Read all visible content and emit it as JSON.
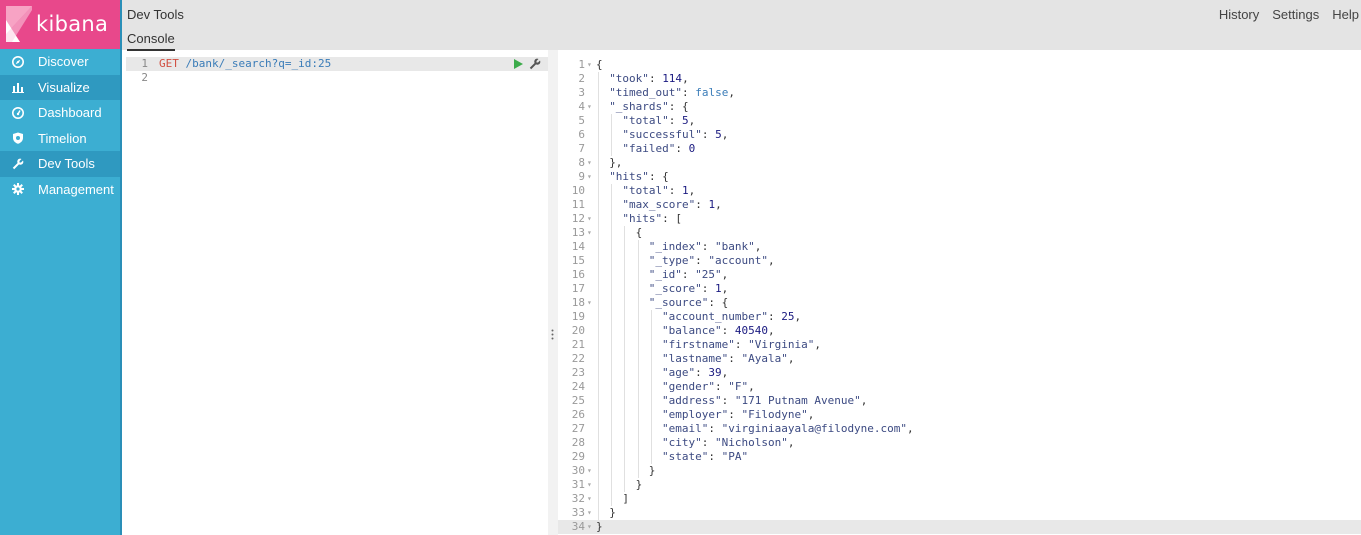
{
  "brand": {
    "name": "kibana",
    "color": "#e8488b",
    "sidebar_color": "#3caed2"
  },
  "sidebar": {
    "items": [
      {
        "label": "Discover",
        "icon": "compass-icon",
        "active": false
      },
      {
        "label": "Visualize",
        "icon": "bar-chart-icon",
        "active": true
      },
      {
        "label": "Dashboard",
        "icon": "dashboard-icon",
        "active": false
      },
      {
        "label": "Timelion",
        "icon": "shield-icon",
        "active": false
      },
      {
        "label": "Dev Tools",
        "icon": "wrench-icon",
        "active": true
      },
      {
        "label": "Management",
        "icon": "gear-icon",
        "active": false
      }
    ]
  },
  "header": {
    "title": "Dev Tools",
    "tab": "Console",
    "links": [
      "History",
      "Settings",
      "Help"
    ]
  },
  "editor": {
    "lines": [
      {
        "n": "1",
        "method": "GET",
        "url": " /bank/_search?q=_id:25"
      },
      {
        "n": "2",
        "method": "",
        "url": ""
      }
    ]
  },
  "output": {
    "lines": [
      {
        "n": "1",
        "fold": true,
        "indent": 0,
        "parts": [
          [
            "p",
            "{"
          ]
        ]
      },
      {
        "n": "2",
        "fold": false,
        "indent": 1,
        "parts": [
          [
            "k",
            "\"took\""
          ],
          [
            "p",
            ": "
          ],
          [
            "n",
            "114"
          ],
          [
            "p",
            ","
          ]
        ]
      },
      {
        "n": "3",
        "fold": false,
        "indent": 1,
        "parts": [
          [
            "k",
            "\"timed_out\""
          ],
          [
            "p",
            ": "
          ],
          [
            "b",
            "false"
          ],
          [
            "p",
            ","
          ]
        ]
      },
      {
        "n": "4",
        "fold": true,
        "indent": 1,
        "parts": [
          [
            "k",
            "\"_shards\""
          ],
          [
            "p",
            ": {"
          ]
        ]
      },
      {
        "n": "5",
        "fold": false,
        "indent": 2,
        "parts": [
          [
            "k",
            "\"total\""
          ],
          [
            "p",
            ": "
          ],
          [
            "n",
            "5"
          ],
          [
            "p",
            ","
          ]
        ]
      },
      {
        "n": "6",
        "fold": false,
        "indent": 2,
        "parts": [
          [
            "k",
            "\"successful\""
          ],
          [
            "p",
            ": "
          ],
          [
            "n",
            "5"
          ],
          [
            "p",
            ","
          ]
        ]
      },
      {
        "n": "7",
        "fold": false,
        "indent": 2,
        "parts": [
          [
            "k",
            "\"failed\""
          ],
          [
            "p",
            ": "
          ],
          [
            "n",
            "0"
          ]
        ]
      },
      {
        "n": "8",
        "fold": true,
        "indent": 1,
        "parts": [
          [
            "p",
            "},"
          ]
        ]
      },
      {
        "n": "9",
        "fold": true,
        "indent": 1,
        "parts": [
          [
            "k",
            "\"hits\""
          ],
          [
            "p",
            ": {"
          ]
        ]
      },
      {
        "n": "10",
        "fold": false,
        "indent": 2,
        "parts": [
          [
            "k",
            "\"total\""
          ],
          [
            "p",
            ": "
          ],
          [
            "n",
            "1"
          ],
          [
            "p",
            ","
          ]
        ]
      },
      {
        "n": "11",
        "fold": false,
        "indent": 2,
        "parts": [
          [
            "k",
            "\"max_score\""
          ],
          [
            "p",
            ": "
          ],
          [
            "n",
            "1"
          ],
          [
            "p",
            ","
          ]
        ]
      },
      {
        "n": "12",
        "fold": true,
        "indent": 2,
        "parts": [
          [
            "k",
            "\"hits\""
          ],
          [
            "p",
            ": ["
          ]
        ]
      },
      {
        "n": "13",
        "fold": true,
        "indent": 3,
        "parts": [
          [
            "p",
            "{"
          ]
        ]
      },
      {
        "n": "14",
        "fold": false,
        "indent": 4,
        "parts": [
          [
            "k",
            "\"_index\""
          ],
          [
            "p",
            ": "
          ],
          [
            "s",
            "\"bank\""
          ],
          [
            "p",
            ","
          ]
        ]
      },
      {
        "n": "15",
        "fold": false,
        "indent": 4,
        "parts": [
          [
            "k",
            "\"_type\""
          ],
          [
            "p",
            ": "
          ],
          [
            "s",
            "\"account\""
          ],
          [
            "p",
            ","
          ]
        ]
      },
      {
        "n": "16",
        "fold": false,
        "indent": 4,
        "parts": [
          [
            "k",
            "\"_id\""
          ],
          [
            "p",
            ": "
          ],
          [
            "s",
            "\"25\""
          ],
          [
            "p",
            ","
          ]
        ]
      },
      {
        "n": "17",
        "fold": false,
        "indent": 4,
        "parts": [
          [
            "k",
            "\"_score\""
          ],
          [
            "p",
            ": "
          ],
          [
            "n",
            "1"
          ],
          [
            "p",
            ","
          ]
        ]
      },
      {
        "n": "18",
        "fold": true,
        "indent": 4,
        "parts": [
          [
            "k",
            "\"_source\""
          ],
          [
            "p",
            ": {"
          ]
        ]
      },
      {
        "n": "19",
        "fold": false,
        "indent": 5,
        "parts": [
          [
            "k",
            "\"account_number\""
          ],
          [
            "p",
            ": "
          ],
          [
            "n",
            "25"
          ],
          [
            "p",
            ","
          ]
        ]
      },
      {
        "n": "20",
        "fold": false,
        "indent": 5,
        "parts": [
          [
            "k",
            "\"balance\""
          ],
          [
            "p",
            ": "
          ],
          [
            "n",
            "40540"
          ],
          [
            "p",
            ","
          ]
        ]
      },
      {
        "n": "21",
        "fold": false,
        "indent": 5,
        "parts": [
          [
            "k",
            "\"firstname\""
          ],
          [
            "p",
            ": "
          ],
          [
            "s",
            "\"Virginia\""
          ],
          [
            "p",
            ","
          ]
        ]
      },
      {
        "n": "22",
        "fold": false,
        "indent": 5,
        "parts": [
          [
            "k",
            "\"lastname\""
          ],
          [
            "p",
            ": "
          ],
          [
            "s",
            "\"Ayala\""
          ],
          [
            "p",
            ","
          ]
        ]
      },
      {
        "n": "23",
        "fold": false,
        "indent": 5,
        "parts": [
          [
            "k",
            "\"age\""
          ],
          [
            "p",
            ": "
          ],
          [
            "n",
            "39"
          ],
          [
            "p",
            ","
          ]
        ]
      },
      {
        "n": "24",
        "fold": false,
        "indent": 5,
        "parts": [
          [
            "k",
            "\"gender\""
          ],
          [
            "p",
            ": "
          ],
          [
            "s",
            "\"F\""
          ],
          [
            "p",
            ","
          ]
        ]
      },
      {
        "n": "25",
        "fold": false,
        "indent": 5,
        "parts": [
          [
            "k",
            "\"address\""
          ],
          [
            "p",
            ": "
          ],
          [
            "s",
            "\"171 Putnam Avenue\""
          ],
          [
            "p",
            ","
          ]
        ]
      },
      {
        "n": "26",
        "fold": false,
        "indent": 5,
        "parts": [
          [
            "k",
            "\"employer\""
          ],
          [
            "p",
            ": "
          ],
          [
            "s",
            "\"Filodyne\""
          ],
          [
            "p",
            ","
          ]
        ]
      },
      {
        "n": "27",
        "fold": false,
        "indent": 5,
        "parts": [
          [
            "k",
            "\"email\""
          ],
          [
            "p",
            ": "
          ],
          [
            "s",
            "\"virginiaayala@filodyne.com\""
          ],
          [
            "p",
            ","
          ]
        ]
      },
      {
        "n": "28",
        "fold": false,
        "indent": 5,
        "parts": [
          [
            "k",
            "\"city\""
          ],
          [
            "p",
            ": "
          ],
          [
            "s",
            "\"Nicholson\""
          ],
          [
            "p",
            ","
          ]
        ]
      },
      {
        "n": "29",
        "fold": false,
        "indent": 5,
        "parts": [
          [
            "k",
            "\"state\""
          ],
          [
            "p",
            ": "
          ],
          [
            "s",
            "\"PA\""
          ]
        ]
      },
      {
        "n": "30",
        "fold": true,
        "indent": 4,
        "parts": [
          [
            "p",
            "}"
          ]
        ]
      },
      {
        "n": "31",
        "fold": true,
        "indent": 3,
        "parts": [
          [
            "p",
            "}"
          ]
        ]
      },
      {
        "n": "32",
        "fold": true,
        "indent": 2,
        "parts": [
          [
            "p",
            "]"
          ]
        ]
      },
      {
        "n": "33",
        "fold": true,
        "indent": 1,
        "parts": [
          [
            "p",
            "}"
          ]
        ]
      },
      {
        "n": "34",
        "fold": true,
        "indent": 0,
        "parts": [
          [
            "p",
            "}"
          ]
        ]
      }
    ]
  }
}
